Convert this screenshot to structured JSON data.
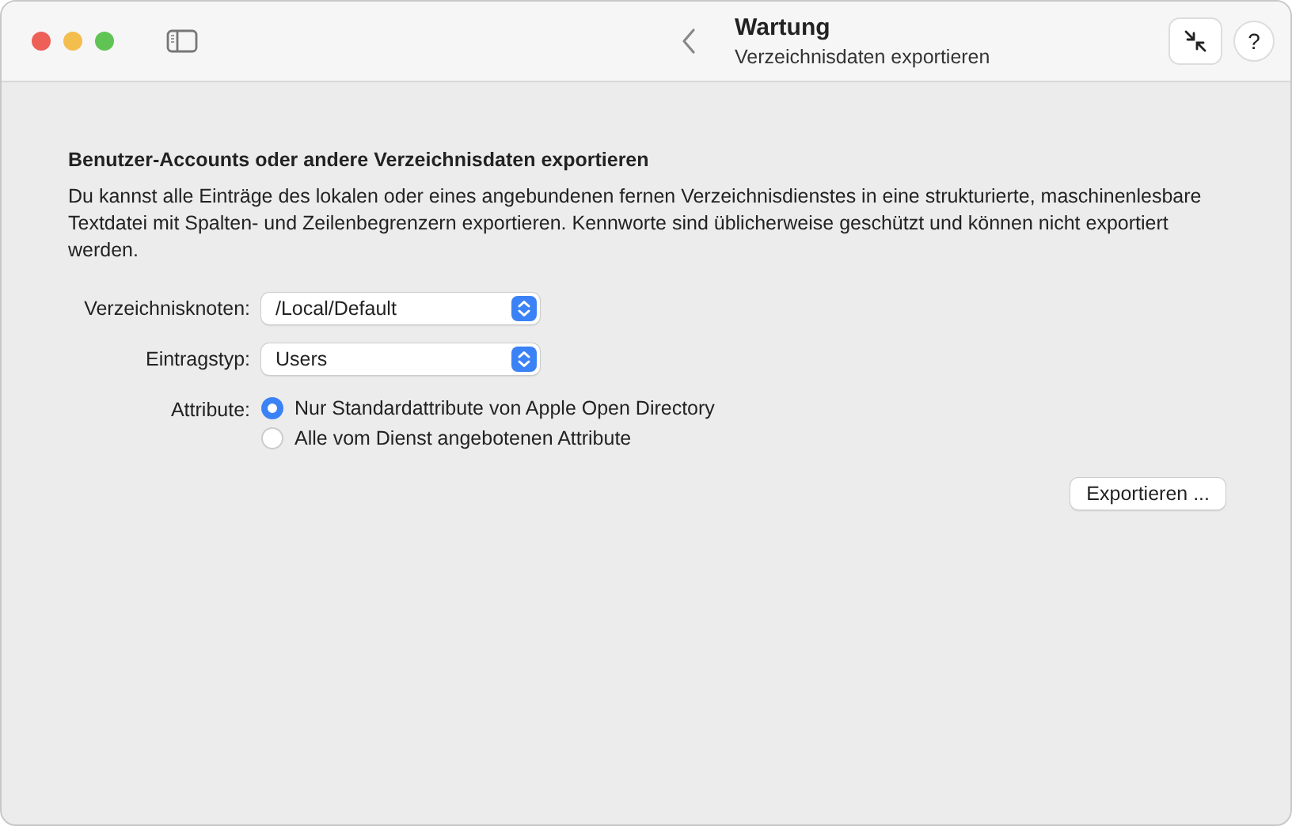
{
  "window": {
    "title": "Wartung",
    "subtitle": "Verzeichnisdaten exportieren"
  },
  "toolbar": {
    "help": "?"
  },
  "section": {
    "heading": "Benutzer-Accounts oder andere Verzeichnisdaten exportieren",
    "description": "Du kannst alle Einträge des lokalen oder eines angebundenen fernen Verzeichnisdienstes in eine strukturierte, maschinenlesbare Textdatei mit Spalten- und Zeilenbegrenzern exportieren. Kennworte sind üblicherweise geschützt und können nicht exportiert werden."
  },
  "fields": [
    {
      "kind": "popup",
      "label": "Verzeichnisknoten:",
      "value": "/Local/Default"
    },
    {
      "kind": "popup",
      "label": "Eintragstyp:",
      "value": "Users"
    },
    {
      "kind": "radio",
      "label": "Attribute:",
      "options": [
        {
          "label": "Nur Standardattribute von Apple Open Directory",
          "selected": true
        },
        {
          "label": "Alle vom Dienst angebotenen Attribute",
          "selected": false
        }
      ]
    }
  ],
  "buttons": [
    "Exportieren ..."
  ]
}
